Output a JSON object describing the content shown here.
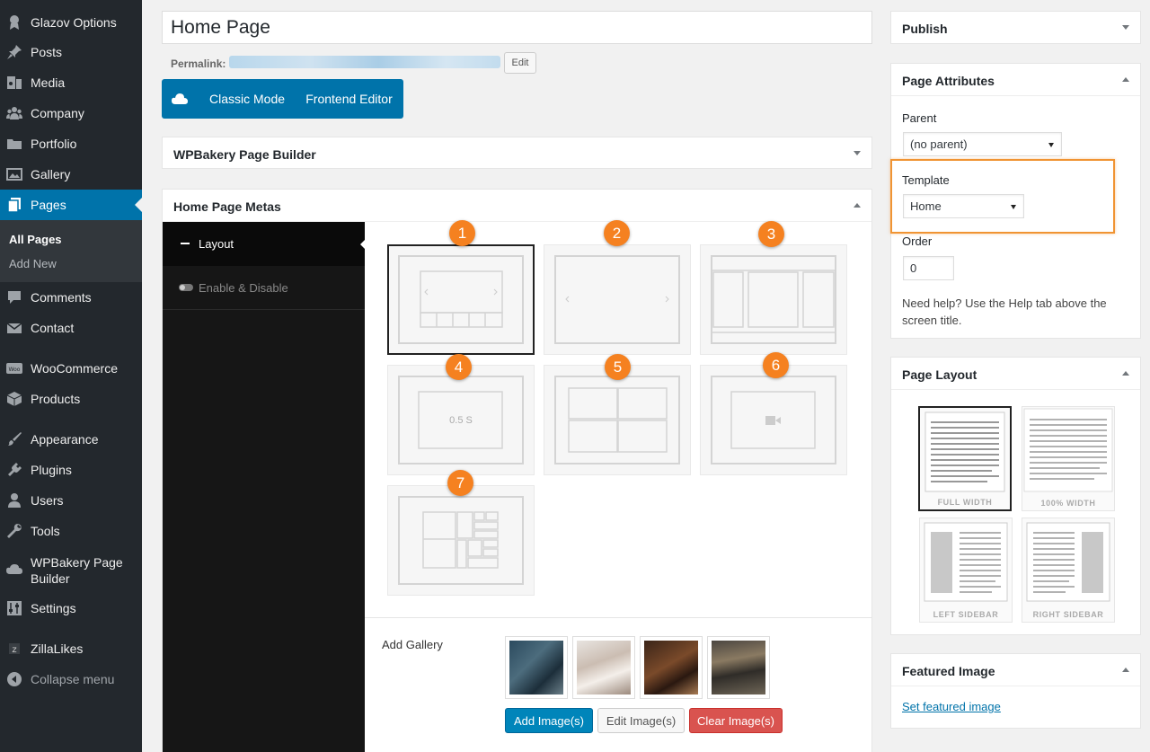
{
  "sidebar": {
    "items": [
      {
        "label": "Glazov Options",
        "icon": "glazov-options-icon"
      },
      {
        "label": "Posts",
        "icon": "pin-icon"
      },
      {
        "label": "Media",
        "icon": "media-icon"
      },
      {
        "label": "Company",
        "icon": "groups-icon"
      },
      {
        "label": "Portfolio",
        "icon": "folder-icon"
      },
      {
        "label": "Gallery",
        "icon": "gallery-icon"
      },
      {
        "label": "Pages",
        "icon": "pages-icon"
      },
      {
        "label": "Comments",
        "icon": "comment-icon"
      },
      {
        "label": "Contact",
        "icon": "mail-icon"
      },
      {
        "label": "WooCommerce",
        "icon": "woo-icon"
      },
      {
        "label": "Products",
        "icon": "cube-icon"
      },
      {
        "label": "Appearance",
        "icon": "brush-icon"
      },
      {
        "label": "Plugins",
        "icon": "plug-icon"
      },
      {
        "label": "Users",
        "icon": "user-icon"
      },
      {
        "label": "Tools",
        "icon": "wrench-icon"
      },
      {
        "label": "WPBakery Page Builder",
        "icon": "cloud-icon"
      },
      {
        "label": "Settings",
        "icon": "sliders-icon"
      },
      {
        "label": "ZillaLikes",
        "icon": "zillalikes-icon"
      },
      {
        "label": "Collapse menu",
        "icon": "collapse-arrow-icon"
      }
    ],
    "submenu": [
      "All Pages",
      "Add New"
    ],
    "active": "Pages"
  },
  "editor": {
    "title_value": "Home Page",
    "permalink_label": "Permalink:",
    "permalink_edit": "Edit",
    "classic_mode": "Classic Mode",
    "frontend_editor": "Frontend Editor"
  },
  "wpbakery_box": {
    "title": "WPBakery Page Builder"
  },
  "metas_box": {
    "title": "Home Page Metas",
    "tabs": [
      "Layout",
      "Enable & Disable"
    ],
    "layout_badges": [
      "1",
      "2",
      "3",
      "4",
      "5",
      "6",
      "7"
    ],
    "tile4_text": "0.5 S",
    "gallery_label": "Add Gallery",
    "buttons": {
      "add": "Add Image(s)",
      "edit": "Edit Image(s)",
      "clear": "Clear Image(s)"
    }
  },
  "publish_box": {
    "title": "Publish"
  },
  "page_attributes": {
    "title": "Page Attributes",
    "parent_label": "Parent",
    "parent_value": "(no parent)",
    "template_label": "Template",
    "template_value": "Home",
    "order_label": "Order",
    "order_value": "0",
    "help_text": "Need help? Use the Help tab above the screen title."
  },
  "page_layout": {
    "title": "Page Layout",
    "options": [
      "FULL WIDTH",
      "100% WIDTH",
      "LEFT SIDEBAR",
      "RIGHT SIDEBAR"
    ],
    "selected": "FULL WIDTH"
  },
  "featured_image": {
    "title": "Featured Image",
    "link": "Set featured image"
  },
  "colors": {
    "accent_blue": "#0073aa",
    "sidebar_bg": "#23282d",
    "badge_orange": "#f58120",
    "highlight_orange": "#f09433",
    "danger_red": "#d9534f"
  }
}
